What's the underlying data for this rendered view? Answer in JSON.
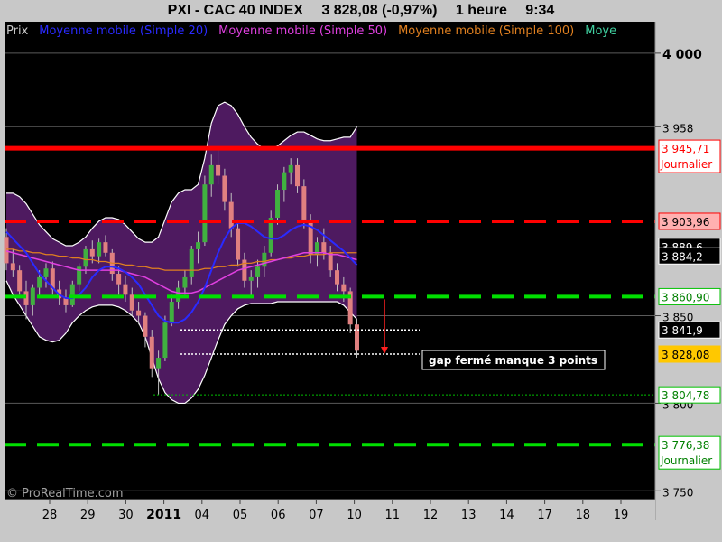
{
  "title": {
    "instrument": "PXI - CAC 40 INDEX",
    "price": "3 828,08 (-0,97%)",
    "timeframe": "1 heure",
    "time": "9:34"
  },
  "legend": [
    {
      "label": "Prix",
      "color": "#c8c8c8"
    },
    {
      "label": "Moyenne mobile (Simple 20)",
      "color": "#2a2aff"
    },
    {
      "label": "Moyenne mobile (Simple 50)",
      "color": "#e040e0"
    },
    {
      "label": "Moyenne mobile (Simple 100)",
      "color": "#e08020"
    },
    {
      "label": "Moye",
      "color": "#40d0a0"
    }
  ],
  "watermark": "© ProRealTime.com",
  "chart_data": {
    "type": "candlestick",
    "ylim": [
      3745,
      4018
    ],
    "x_labels": [
      {
        "label": "28",
        "bold": false
      },
      {
        "label": "29",
        "bold": false
      },
      {
        "label": "30",
        "bold": false
      },
      {
        "label": "2011",
        "bold": true
      },
      {
        "label": "04",
        "bold": false
      },
      {
        "label": "05",
        "bold": false
      },
      {
        "label": "06",
        "bold": false
      },
      {
        "label": "07",
        "bold": false
      },
      {
        "label": "10",
        "bold": false
      },
      {
        "label": "11",
        "bold": false
      },
      {
        "label": "12",
        "bold": false
      },
      {
        "label": "13",
        "bold": false
      },
      {
        "label": "14",
        "bold": false
      },
      {
        "label": "17",
        "bold": false
      },
      {
        "label": "18",
        "bold": false
      },
      {
        "label": "19",
        "bold": false
      }
    ],
    "y_ticks": [
      {
        "value": 4000,
        "label": "4 000",
        "bold": true
      },
      {
        "value": 3958,
        "label": "3 958",
        "bold": false
      },
      {
        "value": 3850,
        "label": "3 850",
        "bold": false
      },
      {
        "value": 3800,
        "label": "3 800",
        "bold": false
      },
      {
        "value": 3750,
        "label": "3 750",
        "bold": false
      }
    ],
    "price_tags": [
      {
        "value": 3945.71,
        "label": "3 945,71",
        "sublabel": "Journalier",
        "bg": "#ffffff",
        "fg": "#ff0000",
        "border": "#ff0000"
      },
      {
        "value": 3903.96,
        "label": "3 903,96",
        "bg": "#ffb0b0",
        "fg": "#000000",
        "border": "#ff0000"
      },
      {
        "value": 3889.6,
        "label": "3 889,6",
        "bg": "#000000",
        "fg": "#ffffff",
        "border": "#ffffff"
      },
      {
        "value": 3884.2,
        "label": "3 884,2",
        "bg": "#000000",
        "fg": "#ffffff",
        "border": "#ffffff"
      },
      {
        "value": 3860.9,
        "label": "3 860,90",
        "bg": "#ffffff",
        "fg": "#008000",
        "border": "#00c000"
      },
      {
        "value": 3841.9,
        "label": "3 841,9",
        "bg": "#000000",
        "fg": "#ffffff",
        "border": "#ffffff"
      },
      {
        "value": 3828.08,
        "label": "3 828,08",
        "bg": "#ffc800",
        "fg": "#000000",
        "border": "#ffc800"
      },
      {
        "value": 3804.78,
        "label": "3 804,78",
        "bg": "#ffffff",
        "fg": "#008000",
        "border": "#00c000"
      },
      {
        "value": 3776.38,
        "label": "3 776,38",
        "sublabel": "Journalier",
        "bg": "#ffffff",
        "fg": "#008000",
        "border": "#00c000"
      }
    ],
    "levels": [
      {
        "name": "resistance-daily",
        "value": 3945.71,
        "color": "#ff0000",
        "style": "solid"
      },
      {
        "name": "resistance-dashed",
        "value": 3903.96,
        "color": "#ff0000",
        "style": "dashed"
      },
      {
        "name": "support-dashed",
        "value": 3860.9,
        "color": "#00e000",
        "style": "dashed"
      },
      {
        "name": "support-dotted",
        "value": 3804.78,
        "color": "#00c000",
        "style": "dotted"
      },
      {
        "name": "support-daily",
        "value": 3776.38,
        "color": "#00e000",
        "style": "dashed"
      }
    ],
    "gap_lines": [
      3841.9,
      3828.08
    ],
    "annotation": "gap fermé manque 3 points",
    "candles": [
      [
        3895,
        3900,
        3876,
        3880
      ],
      [
        3880,
        3888,
        3872,
        3876
      ],
      [
        3876,
        3879,
        3862,
        3864
      ],
      [
        3864,
        3870,
        3848,
        3856
      ],
      [
        3856,
        3868,
        3850,
        3866
      ],
      [
        3866,
        3876,
        3860,
        3872
      ],
      [
        3872,
        3880,
        3866,
        3877
      ],
      [
        3877,
        3881,
        3862,
        3865
      ],
      [
        3865,
        3870,
        3856,
        3860
      ],
      [
        3860,
        3865,
        3852,
        3856
      ],
      [
        3856,
        3870,
        3855,
        3868
      ],
      [
        3868,
        3880,
        3864,
        3878
      ],
      [
        3878,
        3890,
        3874,
        3888
      ],
      [
        3888,
        3893,
        3880,
        3884
      ],
      [
        3884,
        3894,
        3880,
        3892
      ],
      [
        3892,
        3896,
        3884,
        3886
      ],
      [
        3886,
        3888,
        3870,
        3874
      ],
      [
        3874,
        3878,
        3862,
        3868
      ],
      [
        3868,
        3873,
        3858,
        3862
      ],
      [
        3862,
        3866,
        3850,
        3853
      ],
      [
        3853,
        3858,
        3845,
        3850
      ],
      [
        3850,
        3852,
        3832,
        3838
      ],
      [
        3838,
        3842,
        3815,
        3820
      ],
      [
        3820,
        3830,
        3805,
        3826
      ],
      [
        3826,
        3850,
        3824,
        3846
      ],
      [
        3846,
        3862,
        3844,
        3858
      ],
      [
        3858,
        3870,
        3854,
        3866
      ],
      [
        3866,
        3876,
        3862,
        3872
      ],
      [
        3872,
        3890,
        3868,
        3888
      ],
      [
        3888,
        3898,
        3880,
        3892
      ],
      [
        3892,
        3930,
        3890,
        3925
      ],
      [
        3925,
        3942,
        3918,
        3936
      ],
      [
        3936,
        3945,
        3925,
        3930
      ],
      [
        3930,
        3934,
        3910,
        3915
      ],
      [
        3915,
        3920,
        3895,
        3900
      ],
      [
        3900,
        3905,
        3878,
        3882
      ],
      [
        3882,
        3886,
        3866,
        3870
      ],
      [
        3870,
        3876,
        3860,
        3872
      ],
      [
        3872,
        3882,
        3866,
        3878
      ],
      [
        3878,
        3890,
        3872,
        3886
      ],
      [
        3886,
        3910,
        3884,
        3906
      ],
      [
        3906,
        3925,
        3902,
        3922
      ],
      [
        3922,
        3935,
        3915,
        3932
      ],
      [
        3932,
        3940,
        3925,
        3936
      ],
      [
        3936,
        3940,
        3920,
        3924
      ],
      [
        3924,
        3928,
        3900,
        3905
      ],
      [
        3905,
        3908,
        3880,
        3885
      ],
      [
        3885,
        3895,
        3878,
        3892
      ],
      [
        3892,
        3900,
        3882,
        3886
      ],
      [
        3886,
        3890,
        3872,
        3876
      ],
      [
        3876,
        3880,
        3864,
        3868
      ],
      [
        3868,
        3872,
        3858,
        3864
      ],
      [
        3864,
        3866,
        3840,
        3845
      ],
      [
        3845,
        3848,
        3826,
        3830
      ]
    ],
    "ma20": [
      3898,
      3894,
      3890,
      3886,
      3880,
      3874,
      3870,
      3866,
      3862,
      3860,
      3860,
      3862,
      3866,
      3872,
      3876,
      3878,
      3878,
      3877,
      3875,
      3872,
      3868,
      3862,
      3856,
      3850,
      3847,
      3846,
      3846,
      3848,
      3852,
      3858,
      3866,
      3876,
      3886,
      3894,
      3900,
      3903,
      3903,
      3901,
      3898,
      3895,
      3894,
      3894,
      3896,
      3899,
      3901,
      3902,
      3901,
      3899,
      3896,
      3893,
      3890,
      3887,
      3883,
      3879
    ],
    "ma50": [
      3887,
      3886,
      3885,
      3884,
      3883,
      3882,
      3881,
      3880,
      3879,
      3878,
      3877,
      3876,
      3876,
      3876,
      3876,
      3876,
      3876,
      3876,
      3875,
      3874,
      3873,
      3872,
      3870,
      3868,
      3866,
      3864,
      3863,
      3863,
      3863,
      3864,
      3866,
      3868,
      3870,
      3872,
      3874,
      3876,
      3877,
      3878,
      3879,
      3880,
      3881,
      3882,
      3883,
      3884,
      3885,
      3886,
      3886,
      3886,
      3886,
      3885,
      3885,
      3884,
      3883,
      3882
    ],
    "ma100": [
      3888,
      3888,
      3887,
      3887,
      3886,
      3886,
      3885,
      3885,
      3884,
      3884,
      3883,
      3883,
      3882,
      3882,
      3881,
      3881,
      3880,
      3880,
      3879,
      3879,
      3878,
      3878,
      3877,
      3877,
      3876,
      3876,
      3876,
      3876,
      3876,
      3876,
      3877,
      3877,
      3878,
      3878,
      3879,
      3879,
      3880,
      3880,
      3881,
      3881,
      3882,
      3882,
      3883,
      3883,
      3884,
      3884,
      3885,
      3885,
      3885,
      3886,
      3886,
      3886,
      3886,
      3886
    ],
    "bb_upper": [
      3920,
      3920,
      3918,
      3914,
      3908,
      3902,
      3898,
      3894,
      3892,
      3890,
      3890,
      3892,
      3895,
      3900,
      3904,
      3906,
      3906,
      3905,
      3902,
      3898,
      3894,
      3892,
      3892,
      3895,
      3905,
      3915,
      3920,
      3922,
      3922,
      3925,
      3940,
      3960,
      3970,
      3972,
      3970,
      3965,
      3958,
      3952,
      3948,
      3945,
      3945,
      3947,
      3950,
      3953,
      3955,
      3955,
      3953,
      3951,
      3950,
      3950,
      3951,
      3952,
      3952,
      3958
    ],
    "bb_lower": [
      3870,
      3862,
      3856,
      3850,
      3844,
      3838,
      3836,
      3835,
      3836,
      3840,
      3846,
      3850,
      3853,
      3855,
      3856,
      3856,
      3856,
      3855,
      3853,
      3850,
      3846,
      3838,
      3826,
      3814,
      3806,
      3802,
      3800,
      3800,
      3803,
      3808,
      3816,
      3826,
      3836,
      3845,
      3850,
      3854,
      3856,
      3857,
      3857,
      3857,
      3857,
      3858,
      3858,
      3858,
      3858,
      3858,
      3858,
      3858,
      3858,
      3858,
      3858,
      3856,
      3852,
      3848
    ]
  }
}
